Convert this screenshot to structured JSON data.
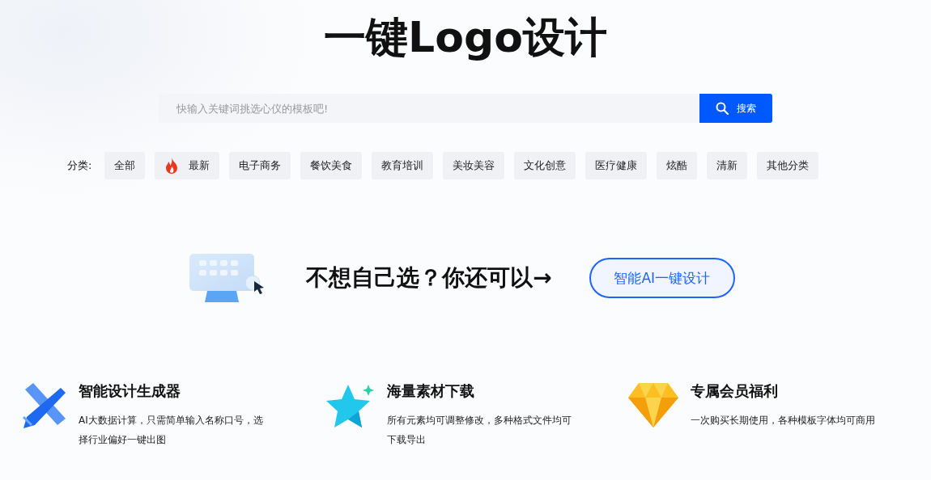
{
  "title": "一键Logo设计",
  "search": {
    "placeholder": "快输入关键词挑选心仪的模板吧!",
    "button": "搜索"
  },
  "categories": {
    "label": "分类:",
    "items": [
      {
        "label": "全部",
        "kind": "plain",
        "selected": false
      },
      {
        "label": "最新",
        "kind": "hot",
        "selected": false
      },
      {
        "label": "电子商务",
        "kind": "plain",
        "selected": false
      },
      {
        "label": "餐饮美食",
        "kind": "plain",
        "selected": false
      },
      {
        "label": "教育培训",
        "kind": "plain",
        "selected": false
      },
      {
        "label": "美妆美容",
        "kind": "plain",
        "selected": false
      },
      {
        "label": "文化创意",
        "kind": "plain",
        "selected": false
      },
      {
        "label": "医疗健康",
        "kind": "plain",
        "selected": false
      },
      {
        "label": "炫酷",
        "kind": "plain",
        "selected": false
      },
      {
        "label": "清新",
        "kind": "plain",
        "selected": false
      },
      {
        "label": "其他分类",
        "kind": "plain",
        "selected": false
      }
    ]
  },
  "promo": {
    "text": "不想自己选？你还可以→",
    "button": "智能AI一键设计"
  },
  "features": [
    {
      "kind": "tools",
      "title": "智能设计生成器",
      "text": "AI大数据计算，只需简单输入名称口号，选择行业偏好一键出图"
    },
    {
      "kind": "star",
      "title": "海量素材下载",
      "text": "所有元素均可调整修改，多种格式文件均可下载导出"
    },
    {
      "kind": "gem",
      "title": "专属会员福利",
      "text": "一次购买长期使用，各种模板字体均可商用"
    }
  ]
}
